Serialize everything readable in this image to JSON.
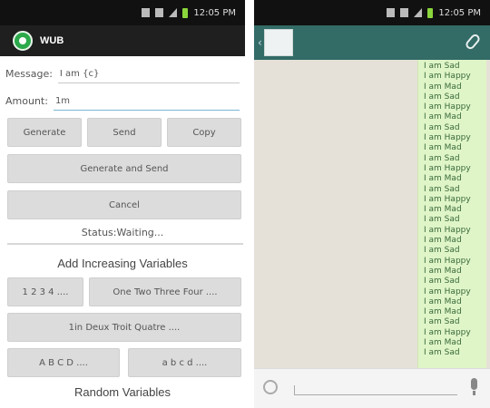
{
  "left": {
    "status_time": "12:05 PM",
    "app_title": "WUB",
    "message_label": "Message:",
    "message_value": "I am {c}",
    "amount_label": "Amount:",
    "amount_value": "1m",
    "buttons": {
      "generate": "Generate",
      "send": "Send",
      "copy": "Copy",
      "generate_and_send": "Generate and Send",
      "cancel": "Cancel",
      "numbers": "1 2 3 4 ....",
      "words": "One Two Three Four ....",
      "roman": "1in Deux Troit Quatre ....",
      "upper_letters": "A B C D ....",
      "lower_letters": "a b c d ...."
    },
    "status": "Status:Waiting...",
    "increasing_title": "Add Increasing Variables",
    "random_title": "Random Variables"
  },
  "right": {
    "status_time": "12:05 PM",
    "messages": [
      "I am Sad",
      "I am Happy",
      "I am Mad",
      "I am Sad",
      "I am Happy",
      "I am Mad",
      "I am Sad",
      "I am Happy",
      "I am Mad",
      "I am Sad",
      "I am Happy",
      "I am Mad",
      "I am Sad",
      "I am Happy",
      "I am Mad",
      "I am Sad",
      "I am Happy",
      "I am Mad",
      "I am Sad",
      "I am Happy",
      "I am Mad",
      "I am Sad",
      "I am Happy",
      "I am Mad",
      "I am Mad",
      "I am Sad",
      "I am Happy",
      "I am Mad",
      "I am Sad"
    ]
  },
  "colors": {
    "chat_header": "#336b66",
    "bubble": "#dff5c8",
    "app_bar": "#1f1f1f"
  }
}
